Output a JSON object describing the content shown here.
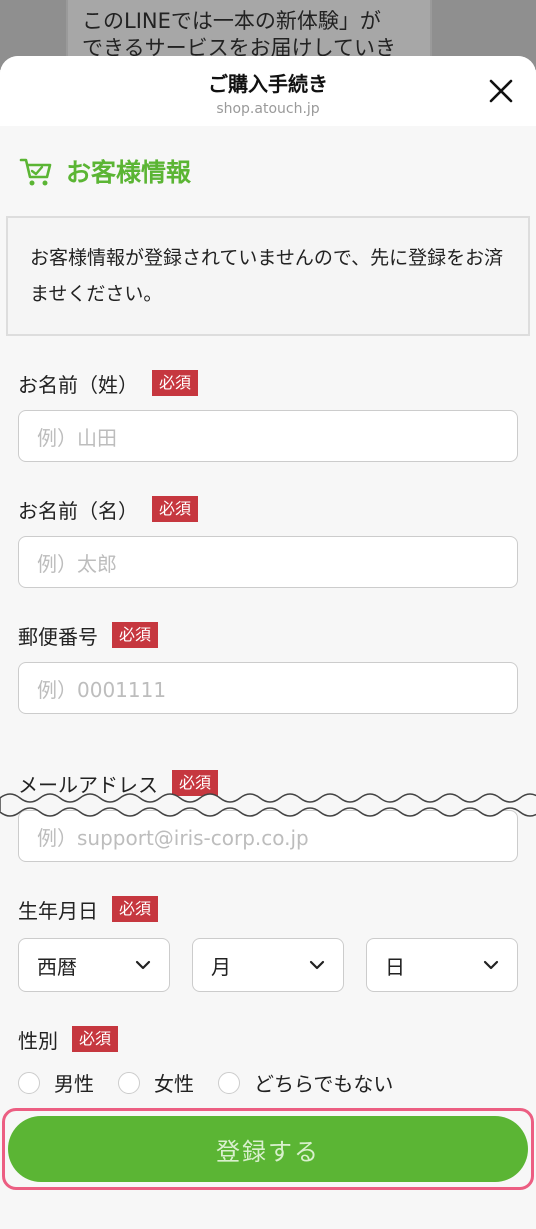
{
  "background": {
    "text": "このLINEでは一本の新体験」が\nできるサービスをお届けしていき\nます"
  },
  "header": {
    "title": "ご購入手続き",
    "subtitle": "shop.atouch.jp"
  },
  "section": {
    "title": "お客様情報"
  },
  "notice": "お客様情報が登録されていませんので、先に登録をお済ませください。",
  "required_label": "必須",
  "fields": [
    {
      "label": "お名前（姓）",
      "placeholder": "例）山田"
    },
    {
      "label": "お名前（名）",
      "placeholder": "例）太郎"
    },
    {
      "label": "郵便番号",
      "placeholder": "例）0001111"
    },
    {
      "label": "メールアドレス",
      "placeholder": "例）support@iris-corp.co.jp"
    }
  ],
  "birthday": {
    "label": "生年月日",
    "year": "西暦",
    "month": "月",
    "day": "日"
  },
  "gender": {
    "label": "性別",
    "options": [
      "男性",
      "女性",
      "どちらでもない"
    ]
  },
  "submit_label": "登録する",
  "colors": {
    "accent_green": "#5bb534",
    "required_red": "#c6373f",
    "highlight_pink": "#ec5e82"
  }
}
